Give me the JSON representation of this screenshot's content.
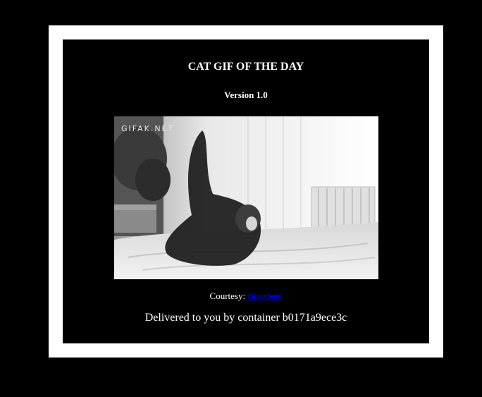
{
  "header": {
    "title": "CAT GIF OF THE DAY",
    "version": "Version 1.0"
  },
  "gif": {
    "watermark": "GIFAK.NET"
  },
  "footer": {
    "courtesy_label": "Courtesy:",
    "courtesy_link": "Buzzfeed",
    "delivered_text": "Delivered to you by container b0171a9ece3c"
  },
  "colors": {
    "page_background": "#000000",
    "frame": "#ffffff",
    "link": "#0000ee"
  }
}
